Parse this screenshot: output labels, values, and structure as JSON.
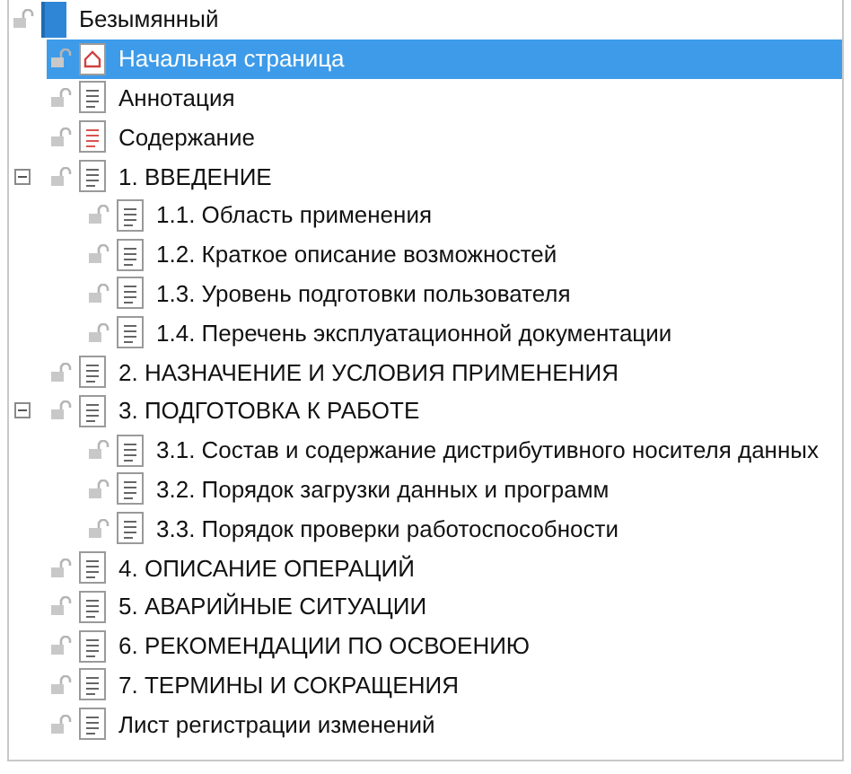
{
  "tree": {
    "label": "Безымянный",
    "kind": "book",
    "selected": false,
    "children": [
      {
        "label": "Начальная страница",
        "kind": "home",
        "selected": true
      },
      {
        "label": "Аннотация",
        "kind": "doc",
        "selected": false
      },
      {
        "label": "Содержание",
        "kind": "toc",
        "selected": false
      },
      {
        "label": "1. ВВЕДЕНИЕ",
        "kind": "doc",
        "selected": false,
        "expanded": true,
        "children": [
          {
            "label": "1.1. Область применения",
            "kind": "doc",
            "selected": false
          },
          {
            "label": "1.2. Краткое описание возможностей",
            "kind": "doc",
            "selected": false
          },
          {
            "label": "1.3. Уровень подготовки пользователя",
            "kind": "doc",
            "selected": false
          },
          {
            "label": "1.4. Перечень эксплуатационной документации",
            "kind": "doc",
            "selected": false
          }
        ]
      },
      {
        "label": "2. НАЗНАЧЕНИЕ И УСЛОВИЯ ПРИМЕНЕНИЯ",
        "kind": "doc",
        "selected": false
      },
      {
        "label": "3. ПОДГОТОВКА К РАБОТЕ",
        "kind": "doc",
        "selected": false,
        "expanded": true,
        "children": [
          {
            "label": "3.1. Состав и содержание дистрибутивного носителя данных",
            "kind": "doc",
            "selected": false
          },
          {
            "label": "3.2. Порядок загрузки данных и программ",
            "kind": "doc",
            "selected": false
          },
          {
            "label": "3.3. Порядок проверки работоспособности",
            "kind": "doc",
            "selected": false
          }
        ]
      },
      {
        "label": "4. ОПИСАНИЕ ОПЕРАЦИЙ",
        "kind": "doc",
        "selected": false
      },
      {
        "label": "5. АВАРИЙНЫЕ СИТУАЦИИ",
        "kind": "doc",
        "selected": false
      },
      {
        "label": "6. РЕКОМЕНДАЦИИ ПО ОСВОЕНИЮ",
        "kind": "doc",
        "selected": false
      },
      {
        "label": "7. ТЕРМИНЫ И СОКРАЩЕНИЯ",
        "kind": "doc",
        "selected": false
      },
      {
        "label": "Лист регистрации изменений",
        "kind": "doc",
        "selected": false
      }
    ]
  }
}
